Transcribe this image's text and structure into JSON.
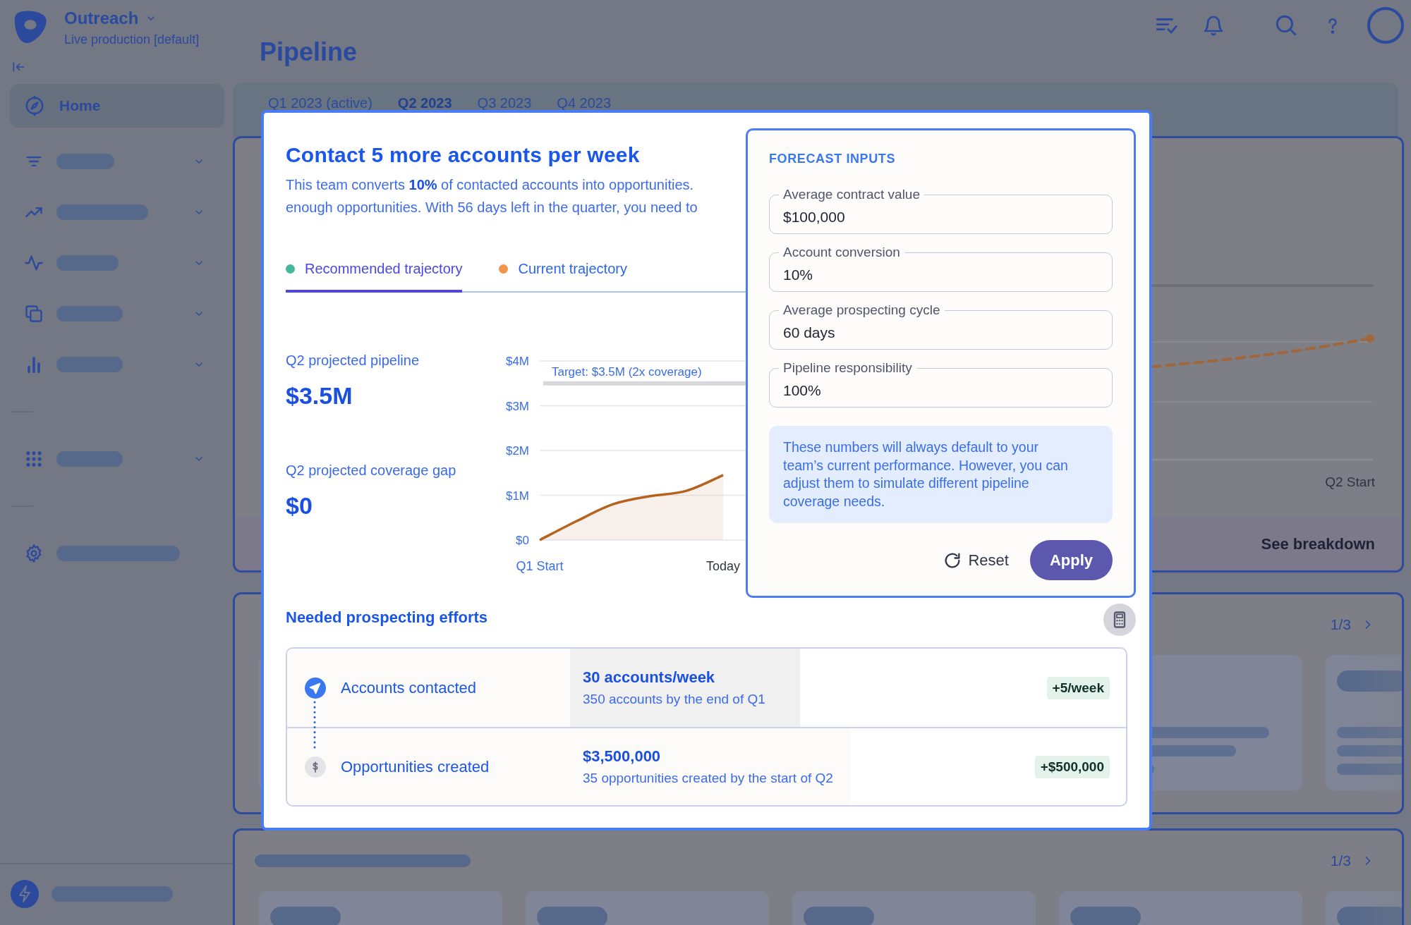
{
  "app": {
    "name": "Outreach",
    "environment": "Live production [default]"
  },
  "sidebar": {
    "sections": [
      {
        "items": [
          {
            "kind": "link",
            "label": "Home",
            "selected": true
          },
          {
            "kind": "placeholder",
            "expandable": true
          },
          {
            "kind": "placeholder",
            "expandable": true
          },
          {
            "kind": "placeholder",
            "expandable": true
          },
          {
            "kind": "placeholder",
            "expandable": true
          },
          {
            "kind": "placeholder",
            "expandable": true
          }
        ]
      },
      {
        "items": [
          {
            "kind": "placeholder",
            "expandable": true
          }
        ]
      },
      {
        "items": [
          {
            "kind": "placeholder"
          }
        ]
      }
    ],
    "footer": {
      "kind": "placeholder"
    }
  },
  "page": {
    "title": "Pipeline",
    "quarter_tabs": [
      {
        "label": "Q1 2023 (active)",
        "selected": false
      },
      {
        "label": "Q2 2023",
        "selected": true
      },
      {
        "label": "Q3 2023",
        "selected": false
      },
      {
        "label": "Q4 2023",
        "selected": false
      }
    ]
  },
  "cards": [
    {
      "kind": "chart",
      "axis_label": "Q2 Start",
      "action": "See breakdown"
    },
    {
      "kind": "carousel",
      "pager": "1/3",
      "header_placeholder": false
    },
    {
      "kind": "carousel",
      "pager": "1/3",
      "header_placeholder": true
    }
  ],
  "modal": {
    "title": "Contact 5 more accounts per week",
    "description_lines": [
      "This team converts **10%** of contacted accounts into opportunities.",
      "enough opportunities. With 56 days left in the quarter, you need to"
    ],
    "tabs": [
      {
        "label": "Recommended trajectory",
        "color": "#45b89a",
        "selected": true
      },
      {
        "label": "Current trajectory",
        "color": "#f0954a",
        "selected": false
      }
    ],
    "stats": [
      {
        "label": "Q2 projected pipeline",
        "value": "$3.5M"
      },
      {
        "label": "Q2 projected coverage gap",
        "value": "$0"
      }
    ],
    "chart_data": {
      "type": "line",
      "grid": true,
      "categories": [
        "Q1 Start",
        null,
        null,
        null,
        null,
        "Today",
        null
      ],
      "ylim": [
        0,
        4
      ],
      "yticks": [
        {
          "value": 0,
          "label": "$0"
        },
        {
          "value": 1,
          "label": "$1M"
        },
        {
          "value": 2,
          "label": "$2M"
        },
        {
          "value": 3,
          "label": "$3M"
        },
        {
          "value": 4,
          "label": "$4M"
        }
      ],
      "series": [
        {
          "color": "#b5621f",
          "values": [
            0,
            0.42,
            0.8,
            0.98,
            1.1,
            1.45,
            null
          ]
        }
      ],
      "ref_lines": [
        {
          "axis": "y",
          "value": 3.5,
          "label": "Target: $3.5M (2x coverage)"
        }
      ]
    },
    "efforts": {
      "title": "Needed prospecting efforts",
      "rows": [
        {
          "kind": "accounts",
          "label": "Accounts contacted",
          "value": "30 accounts/week",
          "detail": "350 accounts by the end of Q1",
          "change": "+5/week",
          "highlighted": true
        },
        {
          "kind": "opportunities",
          "label": "Opportunities created",
          "value": "$3,500,000",
          "detail": "35 opportunities created by the start of Q2",
          "change": "+$500,000",
          "highlighted": false
        }
      ]
    },
    "forecast_inputs": {
      "title": "FORECAST INPUTS",
      "fields": [
        {
          "label": "Average contract value",
          "value": "$100,000"
        },
        {
          "label": "Account conversion",
          "value": "10%"
        },
        {
          "label": "Average prospecting cycle",
          "value": "60 days"
        },
        {
          "label": "Pipeline responsibility",
          "value": "100%"
        }
      ],
      "note": "These numbers will always default to your team’s current performance. However, you can adjust them to simulate different pipeline coverage needs.",
      "buttons": [
        {
          "kind": "reset",
          "label": "Reset"
        },
        {
          "kind": "apply",
          "label": "Apply"
        }
      ]
    }
  }
}
